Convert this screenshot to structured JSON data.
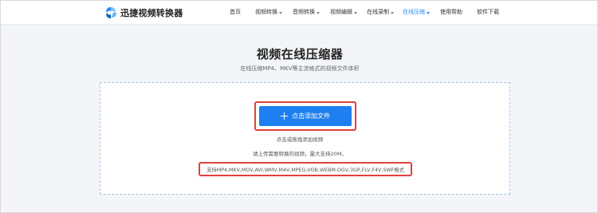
{
  "brand": {
    "name": "迅捷视频转换器",
    "logo_icon": "swirl-logo-icon",
    "accent": "#1e80f0"
  },
  "nav": {
    "items": [
      {
        "label": "首页",
        "has_dropdown": false,
        "active": false
      },
      {
        "label": "视频转换",
        "has_dropdown": true,
        "active": false
      },
      {
        "label": "音频转换",
        "has_dropdown": true,
        "active": false
      },
      {
        "label": "视频编辑",
        "has_dropdown": true,
        "active": false
      },
      {
        "label": "在线录制",
        "has_dropdown": true,
        "active": false
      },
      {
        "label": "在线压缩",
        "has_dropdown": true,
        "active": true
      },
      {
        "label": "使用帮助",
        "has_dropdown": false,
        "active": false
      },
      {
        "label": "软件下载",
        "has_dropdown": false,
        "active": false
      }
    ]
  },
  "main": {
    "title": "视频在线压缩器",
    "subtitle": "在线压缩MP4、MKV等主流格式的视频文件体积",
    "upload_button": "点击添加文件",
    "drag_hint": "点击或拖拽添加视频",
    "limit_text": "请上传需要转换的视频，最大支持20M，",
    "formats_text": "支持MP4,MKV,MOV,AVI,WMV,M4V,MPEG,VOB,WEBM,OGV,3GP,FLV,F4V,SWF格式",
    "highlight_color": "#e0403a"
  }
}
